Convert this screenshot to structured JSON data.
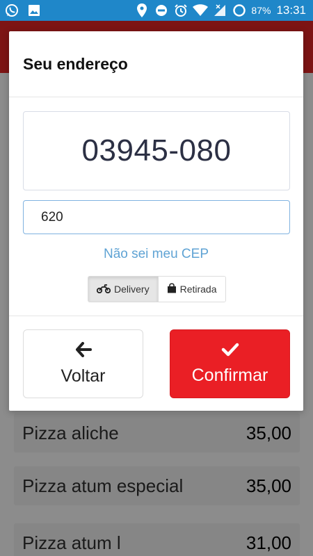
{
  "status_bar": {
    "left_icons": [
      "whatsapp-icon",
      "image-icon"
    ],
    "right_icons": [
      "location-icon",
      "do-not-disturb-icon",
      "alarm-icon",
      "wifi-icon",
      "signal-icon",
      "battery-icon"
    ],
    "battery": "87%",
    "time": "13:31"
  },
  "modal": {
    "title": "Seu endereço",
    "cep_value": "03945-080",
    "number_input_value": "620",
    "dont_know_cep": "Não sei meu CEP",
    "delivery_options": [
      {
        "label": "Delivery",
        "icon": "motorcycle-icon",
        "selected": true
      },
      {
        "label": "Retirada",
        "icon": "shopping-bag-icon",
        "selected": false
      }
    ],
    "back_button": {
      "label": "Voltar",
      "icon": "arrow-left-icon"
    },
    "confirm_button": {
      "label": "Confirmar",
      "icon": "check-icon"
    }
  },
  "background_list": {
    "items": [
      {
        "name": "Pizza aliche",
        "price": "35,00"
      },
      {
        "name": "Pizza atum especial",
        "price": "35,00"
      },
      {
        "name": "Pizza atum l",
        "price": "31,00"
      }
    ]
  },
  "colors": {
    "status_bar": "#1f87c9",
    "header_bg_dimmed": "#7d1414",
    "confirm_red": "#ea1f25",
    "link_blue": "#5fa3d4"
  }
}
